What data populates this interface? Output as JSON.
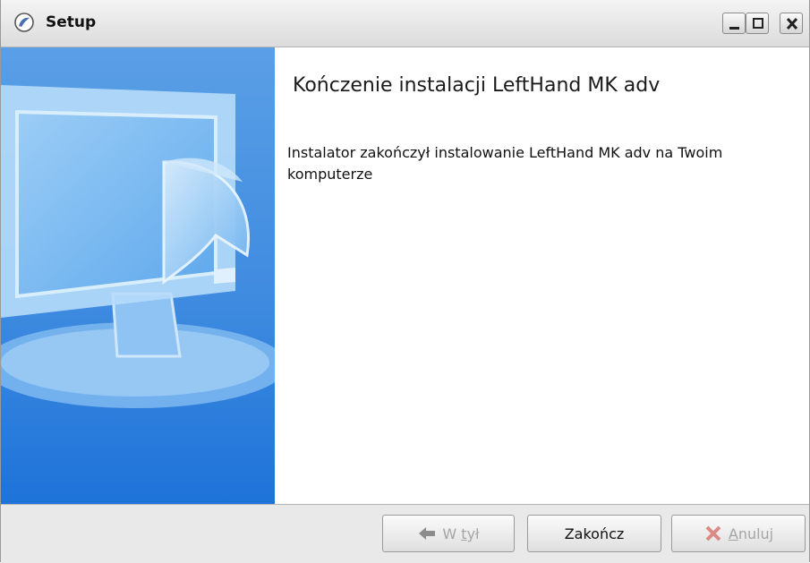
{
  "window": {
    "title": "Setup"
  },
  "page": {
    "heading": "Kończenie instalacji LeftHand MK adv",
    "message": "Instalator zakończył instalowanie LeftHand MK adv na Twoim komputerze"
  },
  "buttons": {
    "back": {
      "label_prefix": "W ",
      "mnemonic": "t",
      "label_suffix": "ył",
      "icon": "arrow-left-icon",
      "enabled": false
    },
    "finish": {
      "label": "Zakończ",
      "enabled": true
    },
    "cancel": {
      "mnemonic": "A",
      "label_suffix": "nuluj",
      "icon": "x-icon",
      "enabled": false
    }
  },
  "colors": {
    "sidebar_top": "#5a9fe6",
    "sidebar_bottom": "#1e73d9",
    "content_bg": "#ffffff",
    "footer_bg": "#e9e9e9",
    "disabled_text": "#a5a5a5"
  }
}
